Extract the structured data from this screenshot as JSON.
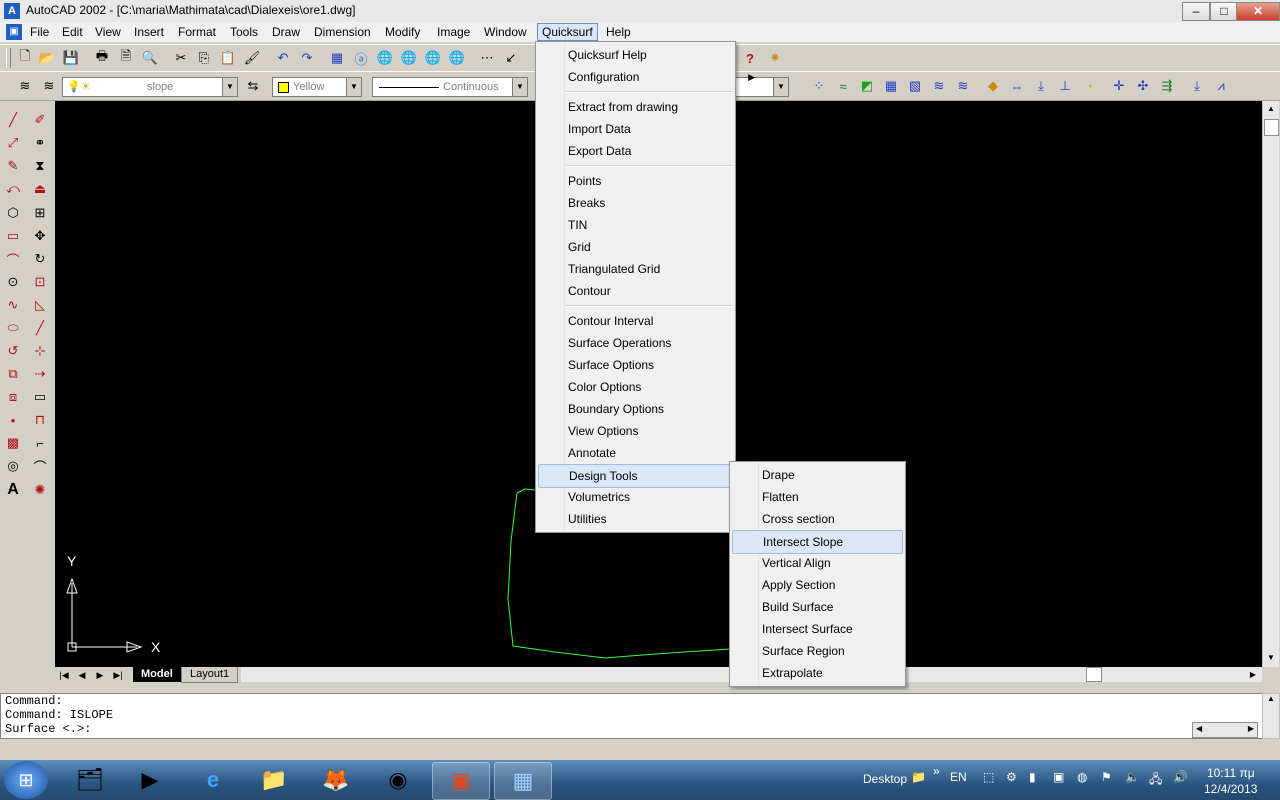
{
  "window": {
    "title": "AutoCAD 2002 - [C:\\maria\\Mathimata\\cad\\Dialexeis\\ore1.dwg]",
    "minimize": "–",
    "maximize": "□",
    "close": "✕"
  },
  "menubar": [
    "File",
    "Edit",
    "View",
    "Insert",
    "Format",
    "Tools",
    "Draw",
    "Dimension",
    "Modify",
    "Image",
    "Window",
    "Quicksurf",
    "Help"
  ],
  "active_menu": "Quicksurf",
  "layer_combo": "slope",
  "color_combo": "Yellow",
  "linetype_combo": "Continuous",
  "quicksurf_menu": [
    {
      "label": "Quicksurf Help",
      "sub": false
    },
    {
      "label": "Configuration",
      "sub": true
    },
    {
      "label": "Extract from drawing",
      "sub": true
    },
    {
      "label": "Import Data",
      "sub": true
    },
    {
      "label": "Export Data",
      "sub": true
    },
    {
      "label": "Points",
      "sub": false
    },
    {
      "label": "Breaks",
      "sub": false
    },
    {
      "label": "TIN",
      "sub": false
    },
    {
      "label": "Grid",
      "sub": false
    },
    {
      "label": "Triangulated Grid",
      "sub": false
    },
    {
      "label": "Contour",
      "sub": false
    },
    {
      "label": "Contour Interval",
      "sub": false
    },
    {
      "label": "Surface Operations",
      "sub": false
    },
    {
      "label": "Surface Options",
      "sub": true
    },
    {
      "label": "Color Options",
      "sub": true
    },
    {
      "label": "Boundary Options",
      "sub": true
    },
    {
      "label": "View Options",
      "sub": true
    },
    {
      "label": "Annotate",
      "sub": true
    },
    {
      "label": "Design Tools",
      "sub": true
    },
    {
      "label": "Volumetrics",
      "sub": true
    },
    {
      "label": "Utilities",
      "sub": true
    }
  ],
  "design_tools_menu": [
    "Drape",
    "Flatten",
    "Cross section",
    "Intersect Slope",
    "Vertical Align",
    "Apply Section",
    "Build Surface",
    "Intersect Surface",
    "Surface Region",
    "Extrapolate"
  ],
  "highlighted_submenu_item": "Intersect Slope",
  "ucs": {
    "y": "Y",
    "x": "X"
  },
  "tabs": [
    "Model",
    "Layout1"
  ],
  "command_lines": [
    "Command:",
    "Command: ISLOPE",
    "Surface <.>:"
  ],
  "taskbar": {
    "desktop_label": "Desktop",
    "lang": "EN",
    "time": "10:11 πμ",
    "date": "12/4/2013"
  },
  "colors": {
    "canvas": "#000000",
    "polyline": "#33ff33",
    "yellow_swatch": "#ffff00"
  }
}
